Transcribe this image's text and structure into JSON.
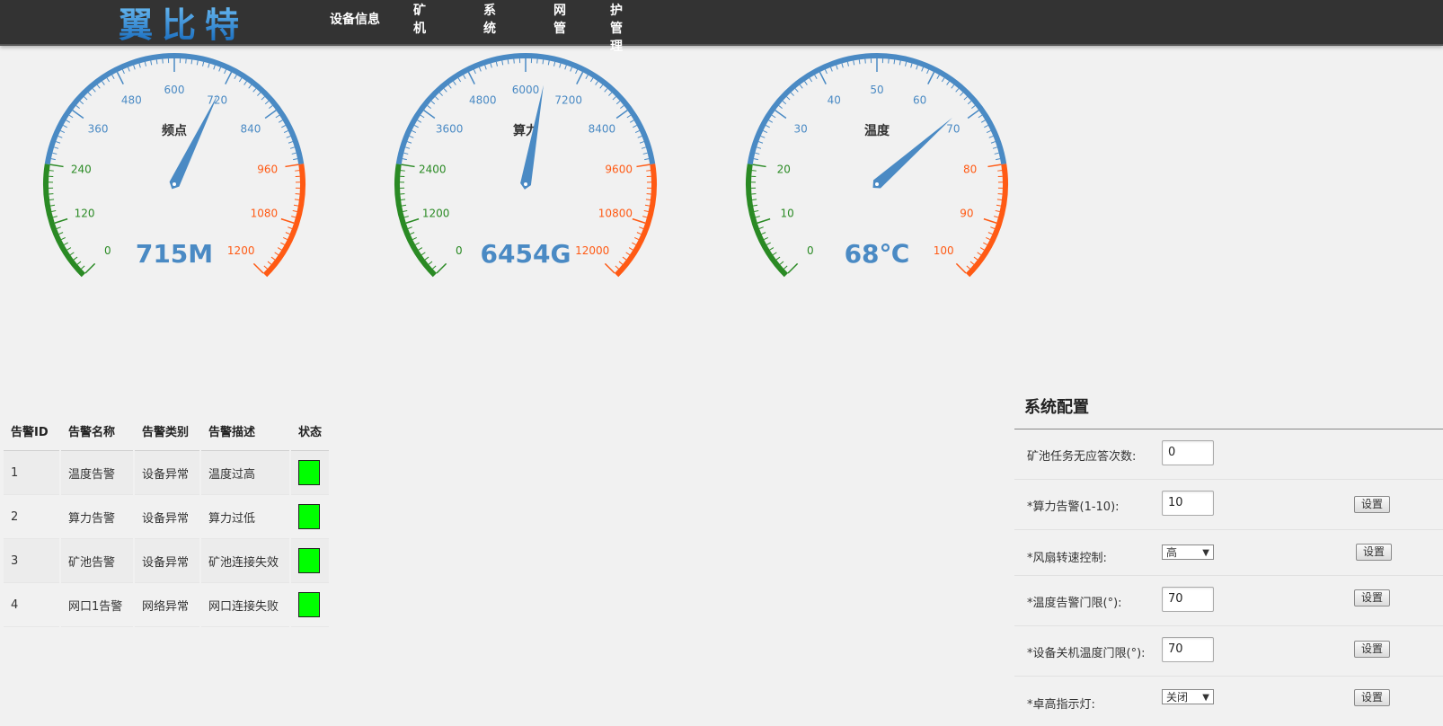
{
  "brand": {
    "logo_text": "翼比特"
  },
  "nav": [
    {
      "label": "设备信息"
    },
    {
      "label": "矿机"
    },
    {
      "label": "系统"
    },
    {
      "label": "网管"
    },
    {
      "label": "维护管理"
    }
  ],
  "gauges": [
    {
      "title": "频点",
      "value": 715,
      "unit": "M",
      "readout": "715M",
      "min": 0,
      "max": 1200,
      "ticks": [
        "0",
        "120",
        "240",
        "360",
        "480",
        "600",
        "720",
        "840",
        "960",
        "1080",
        "1200"
      ]
    },
    {
      "title": "算力",
      "value": 6454,
      "unit": "G",
      "readout": "6454G",
      "min": 0,
      "max": 12000,
      "ticks": [
        "0",
        "1200",
        "2400",
        "3600",
        "4800",
        "6000",
        "7200",
        "8400",
        "9600",
        "10800",
        "12000"
      ]
    },
    {
      "title": "温度",
      "value": 68,
      "unit": "℃",
      "readout": "68℃",
      "min": 0,
      "max": 100,
      "ticks": [
        "0",
        "10",
        "20",
        "30",
        "40",
        "50",
        "60",
        "70",
        "80",
        "90",
        "100"
      ]
    }
  ],
  "colors": {
    "low": "#2a8a24",
    "mid": "#4a8ac4",
    "high": "#ff5a14",
    "status_ok": "#00ff00",
    "topbar": "#333333"
  },
  "alarms": {
    "headers": [
      "告警ID",
      "告警名称",
      "告警类别",
      "告警描述",
      "状态"
    ],
    "rows": [
      {
        "id": "1",
        "name": "温度告警",
        "category": "设备异常",
        "desc": "温度过高",
        "status": "ok"
      },
      {
        "id": "2",
        "name": "算力告警",
        "category": "设备异常",
        "desc": "算力过低",
        "status": "ok"
      },
      {
        "id": "3",
        "name": "矿池告警",
        "category": "设备异常",
        "desc": "矿池连接失效",
        "status": "ok"
      },
      {
        "id": "4",
        "name": "网口1告警",
        "category": "网络异常",
        "desc": "网口连接失败",
        "status": "ok"
      }
    ]
  },
  "config": {
    "title": "系统配置",
    "rows": [
      {
        "label": "矿池任务无应答次数:",
        "value": "0"
      },
      {
        "label": "*算力告警(1-10):",
        "value": "10",
        "button": "设置"
      },
      {
        "label": "*风扇转速控制:",
        "select": "高",
        "button": "设置"
      },
      {
        "label": "*温度告警门限(°):",
        "value": "70",
        "button": "设置"
      },
      {
        "label": "*设备关机温度门限(°):",
        "value": "70",
        "button": "设置"
      },
      {
        "label": "*卓高指示灯:",
        "select": "关闭",
        "button": "设置"
      }
    ]
  }
}
